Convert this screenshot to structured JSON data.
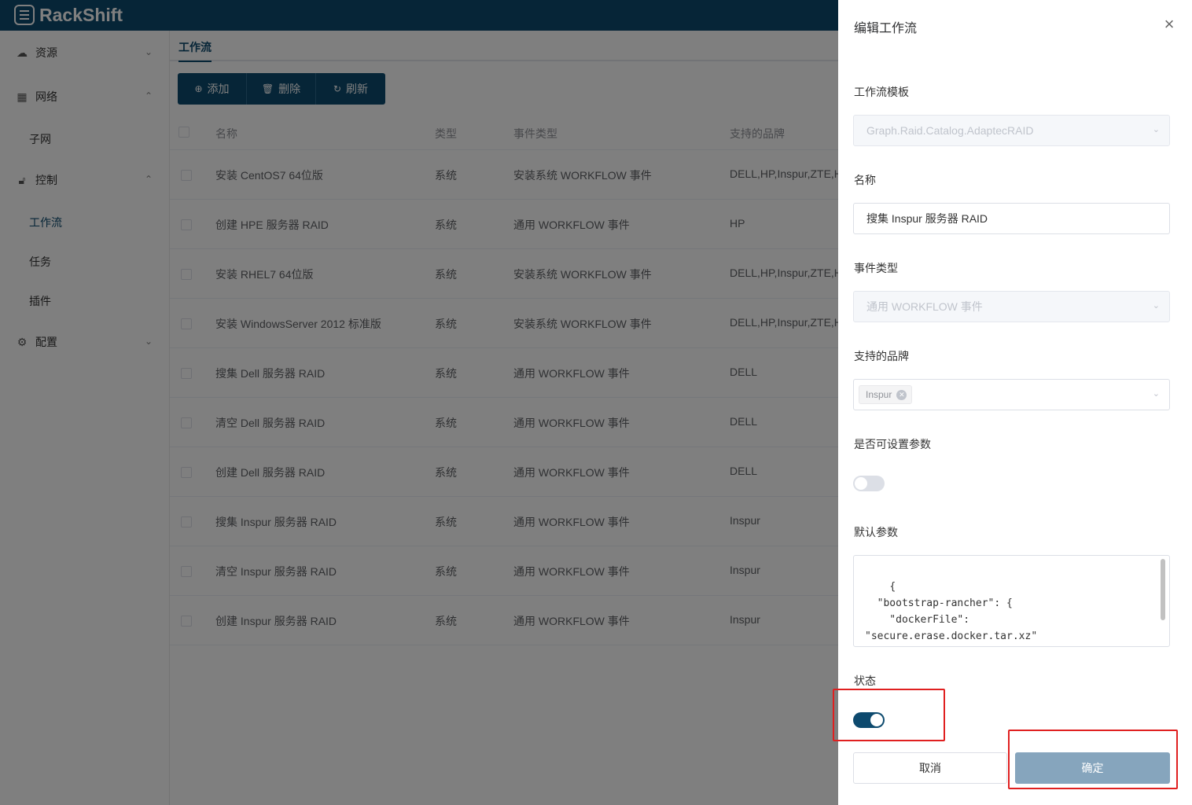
{
  "app": {
    "brand": "RackShift"
  },
  "sidebar": {
    "groups": [
      {
        "label": "资源",
        "icon": "cloud-icon",
        "expanded": false
      },
      {
        "label": "网络",
        "icon": "grid-icon",
        "expanded": true
      },
      {
        "label": "控制",
        "icon": "lock-icon",
        "expanded": true
      },
      {
        "label": "配置",
        "icon": "gear-icon",
        "expanded": false
      }
    ],
    "items": [
      {
        "label": "子网",
        "active": false
      },
      {
        "label": "工作流",
        "active": true
      },
      {
        "label": "任务",
        "active": false
      },
      {
        "label": "插件",
        "active": false
      }
    ]
  },
  "main": {
    "tab": "工作流",
    "toolbar": {
      "add": "添加",
      "delete": "删除",
      "refresh": "刷新"
    },
    "columns": [
      "名称",
      "类型",
      "事件类型",
      "支持的品牌"
    ],
    "rows": [
      [
        "安装 CentOS7 64位版",
        "系统",
        "安装系统 WORKFLOW 事件",
        "DELL,HP,Inspur,ZTE,H"
      ],
      [
        "创建 HPE 服务器 RAID",
        "系统",
        "通用 WORKFLOW 事件",
        "HP"
      ],
      [
        "安装 RHEL7 64位版",
        "系统",
        "安装系统 WORKFLOW 事件",
        "DELL,HP,Inspur,ZTE,H"
      ],
      [
        "安装 WindowsServer 2012 标准版",
        "系统",
        "安装系统 WORKFLOW 事件",
        "DELL,HP,Inspur,ZTE,H"
      ],
      [
        "搜集 Dell 服务器 RAID",
        "系统",
        "通用 WORKFLOW 事件",
        "DELL"
      ],
      [
        "清空 Dell 服务器 RAID",
        "系统",
        "通用 WORKFLOW 事件",
        "DELL"
      ],
      [
        "创建 Dell 服务器 RAID",
        "系统",
        "通用 WORKFLOW 事件",
        "DELL"
      ],
      [
        "搜集 Inspur 服务器 RAID",
        "系统",
        "通用 WORKFLOW 事件",
        "Inspur"
      ],
      [
        "清空 Inspur 服务器 RAID",
        "系统",
        "通用 WORKFLOW 事件",
        "Inspur"
      ],
      [
        "创建 Inspur 服务器 RAID",
        "系统",
        "通用 WORKFLOW 事件",
        "Inspur"
      ]
    ]
  },
  "drawer": {
    "title": "编辑工作流",
    "template_label": "工作流模板",
    "template_value": "Graph.Raid.Catalog.AdaptecRAID",
    "name_label": "名称",
    "name_value": "搜集 Inspur 服务器 RAID",
    "event_label": "事件类型",
    "event_value": "通用 WORKFLOW 事件",
    "brand_label": "支持的品牌",
    "brand_tag": "Inspur",
    "settable_label": "是否可设置参数",
    "settable_on": false,
    "params_label": "默认参数",
    "params_value": "{\n  \"bootstrap-rancher\": {\n    \"dockerFile\":\n\"secure.erase.docker.tar.xz\"\n  }",
    "status_label": "状态",
    "status_on": true,
    "cancel": "取消",
    "confirm": "确定"
  },
  "colors": {
    "primary": "#0d4a6e",
    "confirm_disabled": "#86a5bd",
    "highlight": "#e02020"
  }
}
